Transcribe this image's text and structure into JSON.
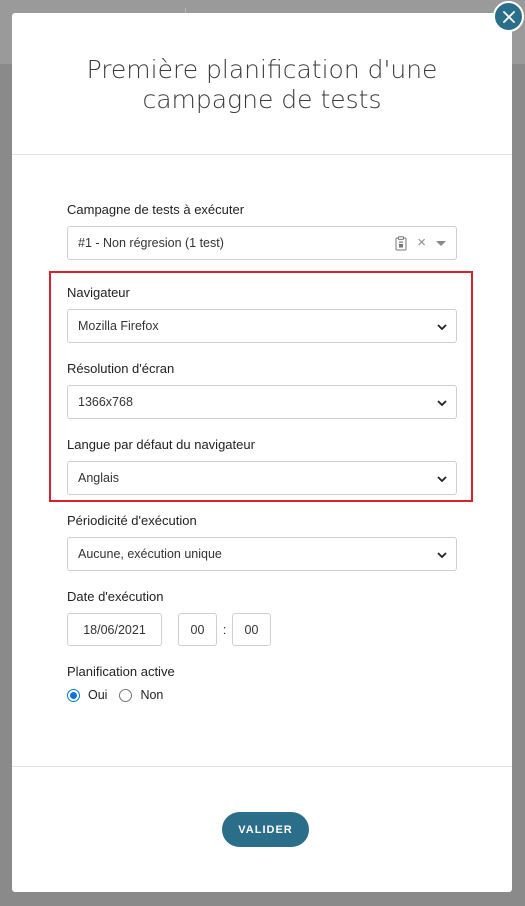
{
  "modal": {
    "title": "Première planification d'une campagne de tests"
  },
  "fields": {
    "campaign": {
      "label": "Campagne de tests à exécuter",
      "value": "#1 - Non régresion (1 test)"
    },
    "browser": {
      "label": "Navigateur",
      "value": "Mozilla Firefox"
    },
    "resolution": {
      "label": "Résolution d'écran",
      "value": "1366x768"
    },
    "language": {
      "label": "Langue par défaut du navigateur",
      "value": "Anglais"
    },
    "periodicity": {
      "label": "Périodicité d'exécution",
      "value": "Aucune, exécution unique"
    },
    "date": {
      "label": "Date d'exécution",
      "value": "18/06/2021",
      "hour": "00",
      "separator": ":",
      "minute": "00"
    },
    "active": {
      "label": "Planification active",
      "options": [
        {
          "label": "Oui",
          "checked": true
        },
        {
          "label": "Non",
          "checked": false
        }
      ]
    }
  },
  "actions": {
    "submit_label": "VALIDER"
  },
  "icons": {
    "close": "close-icon",
    "chevron": "chevron-down-icon",
    "clipboard": "clipboard-icon",
    "clear": "clear-icon"
  },
  "colors": {
    "accent": "#2b6e8a",
    "highlight": "#d9212e",
    "radio": "#0b74d8"
  }
}
